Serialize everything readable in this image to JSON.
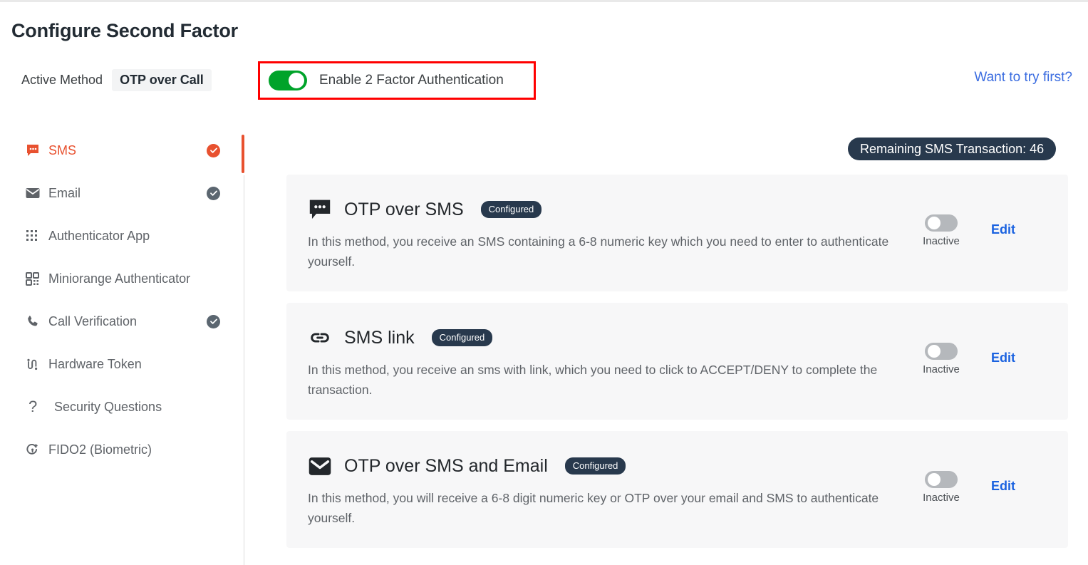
{
  "header": {
    "title": "Configure Second Factor",
    "active_method_label": "Active Method",
    "active_method_value": "OTP over Call",
    "enable_2fa_label": "Enable 2 Factor Authentication",
    "enable_2fa_state": "on",
    "try_first_link": "Want to try first?",
    "highlight_color": "#ff0000",
    "toggle_on_color": "#00a32a",
    "link_color": "#3a6ce0"
  },
  "sidebar": {
    "active_accent": "#e8512f",
    "items": [
      {
        "label": "SMS",
        "icon": "sms-chat-icon",
        "active": true,
        "configured": true,
        "check_style": "orange"
      },
      {
        "label": "Email",
        "icon": "envelope-icon",
        "active": false,
        "configured": true,
        "check_style": "gray"
      },
      {
        "label": "Authenticator App",
        "icon": "grid-dots-icon",
        "active": false,
        "configured": false,
        "check_style": ""
      },
      {
        "label": "Miniorange Authenticator",
        "icon": "qr-code-icon",
        "active": false,
        "configured": false,
        "check_style": ""
      },
      {
        "label": "Call Verification",
        "icon": "phone-icon",
        "active": false,
        "configured": true,
        "check_style": "gray"
      },
      {
        "label": "Hardware Token",
        "icon": "hardware-token-icon",
        "active": false,
        "configured": false,
        "check_style": ""
      },
      {
        "label": "Security Questions",
        "icon": "question-mark-icon",
        "active": false,
        "configured": false,
        "check_style": ""
      },
      {
        "label": "FIDO2 (Biometric)",
        "icon": "fingerprint-key-icon",
        "active": false,
        "configured": false,
        "check_style": ""
      }
    ]
  },
  "main": {
    "remaining_badge": "Remaining SMS Transaction: 46",
    "badge_color": "#28394d",
    "cards": [
      {
        "icon": "sms-chat-icon",
        "title": "OTP over SMS",
        "badge": "Configured",
        "description": "In this method, you receive an SMS containing a 6-8 numeric key which you need to enter to authenticate yourself.",
        "toggle_state": "Inactive",
        "edit_label": "Edit"
      },
      {
        "icon": "link-chain-icon",
        "title": "SMS link",
        "badge": "Configured",
        "description": "In this method, you receive an sms with link, which you need to click to ACCEPT/DENY to complete the transaction.",
        "toggle_state": "Inactive",
        "edit_label": "Edit"
      },
      {
        "icon": "envelope-icon",
        "title": "OTP over SMS and Email",
        "badge": "Configured",
        "description": "In this method, you will receive a 6-8 digit numeric key or OTP over your email and SMS to authenticate yourself.",
        "toggle_state": "Inactive",
        "edit_label": "Edit"
      }
    ]
  }
}
